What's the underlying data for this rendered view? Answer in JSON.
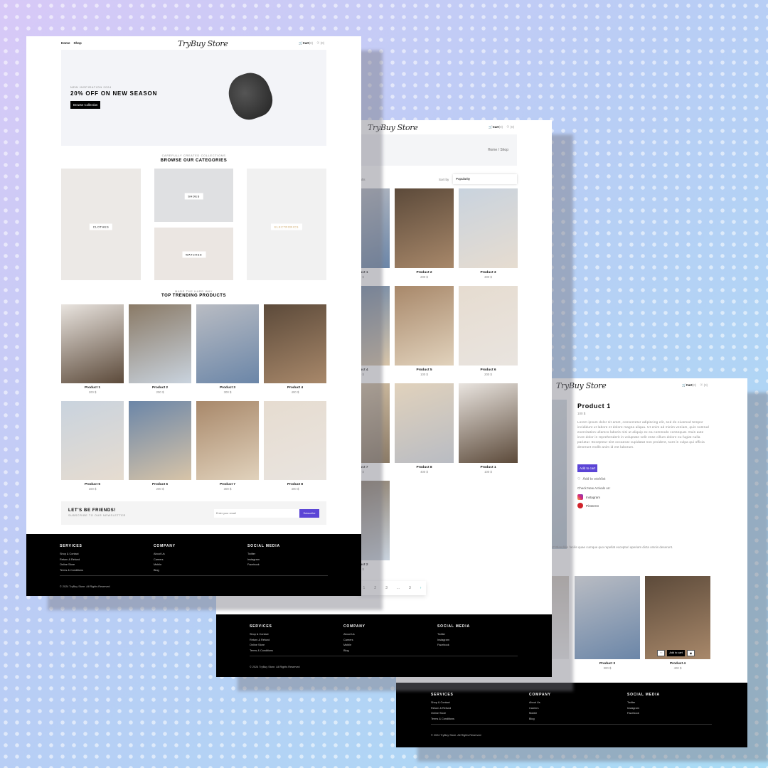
{
  "brand": "TryBuy Store",
  "colors": {
    "accent": "#5b45d6",
    "footer": "#000000",
    "hero_bg": "#f3f4f8"
  },
  "header": {
    "nav": [
      "Home",
      "Shop"
    ],
    "cart_label": "Cart",
    "cart_count": "(0)",
    "wishlist_count": "(0)"
  },
  "home": {
    "hero": {
      "eyebrow": "NEW INSPIRATION 2024",
      "title": "20% OFF ON NEW SEASON",
      "button": "Browse Collection"
    },
    "categories": {
      "eyebrow": "CAREFULLY CREATED COLLECTIONS",
      "title": "BROWSE OUR CATEGORIES",
      "items": [
        "CLOTHES",
        "SHOES",
        "WATCHES",
        "ELECTRONICS"
      ]
    },
    "trending": {
      "eyebrow": "MADE THE HARD WAY",
      "title": "TOP TRENDING PRODUCTS",
      "products": [
        {
          "name": "Product 1",
          "price": "100 $"
        },
        {
          "name": "Product 2",
          "price": "200 $"
        },
        {
          "name": "Product 3",
          "price": "300 $"
        },
        {
          "name": "Product 4",
          "price": "400 $"
        },
        {
          "name": "Product 5",
          "price": "100 $"
        },
        {
          "name": "Product 6",
          "price": "200 $"
        },
        {
          "name": "Product 7",
          "price": "300 $"
        },
        {
          "name": "Product 8",
          "price": "400 $"
        }
      ]
    },
    "newsletter": {
      "title": "LET'S BE FRIENDS!",
      "subtitle": "SUBSCRIBE TO OUR NEWSLETTER",
      "placeholder": "Enter your email",
      "button": "Subscribe"
    }
  },
  "shop": {
    "breadcrumb": "Home  / Shop",
    "results": "17 results",
    "sort_label": "Sort by",
    "sort_value": "Popularity",
    "products": [
      {
        "name": "Product 1",
        "price": "100 $"
      },
      {
        "name": "Product 2",
        "price": "200 $"
      },
      {
        "name": "Product 3",
        "price": "300 $"
      },
      {
        "name": "Product 4",
        "price": "400 $"
      },
      {
        "name": "Product 5",
        "price": "100 $"
      },
      {
        "name": "Product 6",
        "price": "200 $"
      },
      {
        "name": "Product 7",
        "price": "300 $"
      },
      {
        "name": "Product 8",
        "price": "400 $"
      },
      {
        "name": "Product 1",
        "price": "100 $"
      },
      {
        "name": "Product 2",
        "price": "200 $"
      }
    ],
    "pagination": [
      "1",
      "2",
      "3",
      "...",
      "3",
      "›"
    ]
  },
  "product": {
    "title": "Product 1",
    "price": "100 $",
    "description": "Lorem ipsum dolor sit amet, consectetur adipiscing elit, sed do eiusmod tempor incididunt ut labore et dolore magna aliqua. Ut enim ad minim veniam, quis nostrud exercitation ullamco laboris nisi ut aliquip ex ea commodo consequat. Duis aute irure dolor in reprehenderit in voluptate velit esse cillum dolore eu fugiat nulla pariatur. Excepteur sint occaecat cupidatat non proident, sunt in culpa qui officia deserunt mollit anim id est laborum.",
    "add_to_cart": "Add to cart",
    "wishlist": "Add to wishlist",
    "arrivals": "Check New Arrivals on:",
    "social": [
      "Instagram",
      "Pinterest"
    ],
    "extra_text": "dis, saepe? Blanditiis facilis quae cumque quo repellat excepturi aperiam dicta omnis deserunt.",
    "related": [
      {
        "name": "Product 3",
        "price": "300 $"
      },
      {
        "name": "Product 4",
        "price": "400 $"
      }
    ],
    "hover_add": "Add to cart"
  },
  "footer": {
    "columns": [
      {
        "title": "SERVICES",
        "links": [
          "Shop & Contact",
          "Return & Refund",
          "Online Store",
          "Terms & Conditions"
        ]
      },
      {
        "title": "COMPANY",
        "links": [
          "About Us",
          "Careers",
          "Mobile",
          "Blog"
        ]
      },
      {
        "title": "SOCIAL MEDIA",
        "links": [
          "Twitter",
          "Instagram",
          "Facebook"
        ]
      }
    ],
    "copyright": "© 2024 TryBuy Store. All Rights Reserved"
  }
}
